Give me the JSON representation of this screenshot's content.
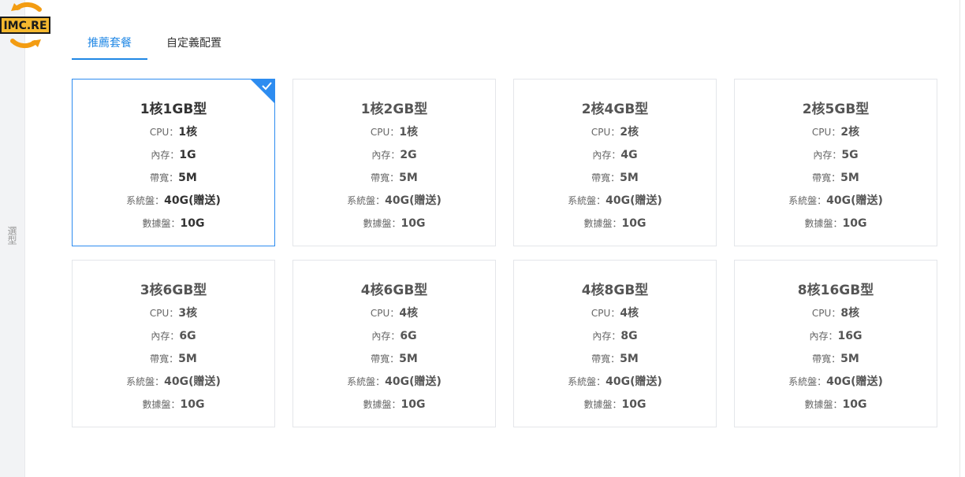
{
  "brand": {
    "logo_text": "IMC.RE"
  },
  "left_rail": {
    "label": "選型"
  },
  "tabs": [
    {
      "label": "推薦套餐",
      "active": true
    },
    {
      "label": "自定義配置",
      "active": false
    }
  ],
  "spec_labels": {
    "cpu": "CPU：",
    "memory": "內存：",
    "bandwidth": "帶寬：",
    "system_disk": "系統盤：",
    "data_disk": "數據盤："
  },
  "plans": [
    {
      "title": "1核1GB型",
      "cpu": "1核",
      "memory": "1G",
      "bandwidth": "5M",
      "system_disk": "40G(贈送)",
      "data_disk": "10G",
      "selected": true
    },
    {
      "title": "1核2GB型",
      "cpu": "1核",
      "memory": "2G",
      "bandwidth": "5M",
      "system_disk": "40G(贈送)",
      "data_disk": "10G",
      "selected": false
    },
    {
      "title": "2核4GB型",
      "cpu": "2核",
      "memory": "4G",
      "bandwidth": "5M",
      "system_disk": "40G(贈送)",
      "data_disk": "10G",
      "selected": false
    },
    {
      "title": "2核5GB型",
      "cpu": "2核",
      "memory": "5G",
      "bandwidth": "5M",
      "system_disk": "40G(贈送)",
      "data_disk": "10G",
      "selected": false
    },
    {
      "title": "3核6GB型",
      "cpu": "3核",
      "memory": "6G",
      "bandwidth": "5M",
      "system_disk": "40G(贈送)",
      "data_disk": "10G",
      "selected": false
    },
    {
      "title": "4核6GB型",
      "cpu": "4核",
      "memory": "6G",
      "bandwidth": "5M",
      "system_disk": "40G(贈送)",
      "data_disk": "10G",
      "selected": false
    },
    {
      "title": "4核8GB型",
      "cpu": "4核",
      "memory": "8G",
      "bandwidth": "5M",
      "system_disk": "40G(贈送)",
      "data_disk": "10G",
      "selected": false
    },
    {
      "title": "8核16GB型",
      "cpu": "8核",
      "memory": "16G",
      "bandwidth": "5M",
      "system_disk": "40G(贈送)",
      "data_disk": "10G",
      "selected": false
    }
  ],
  "colors": {
    "accent": "#2d8cf0",
    "tab_active": "#1f87e5",
    "border": "#e4e6ea"
  }
}
